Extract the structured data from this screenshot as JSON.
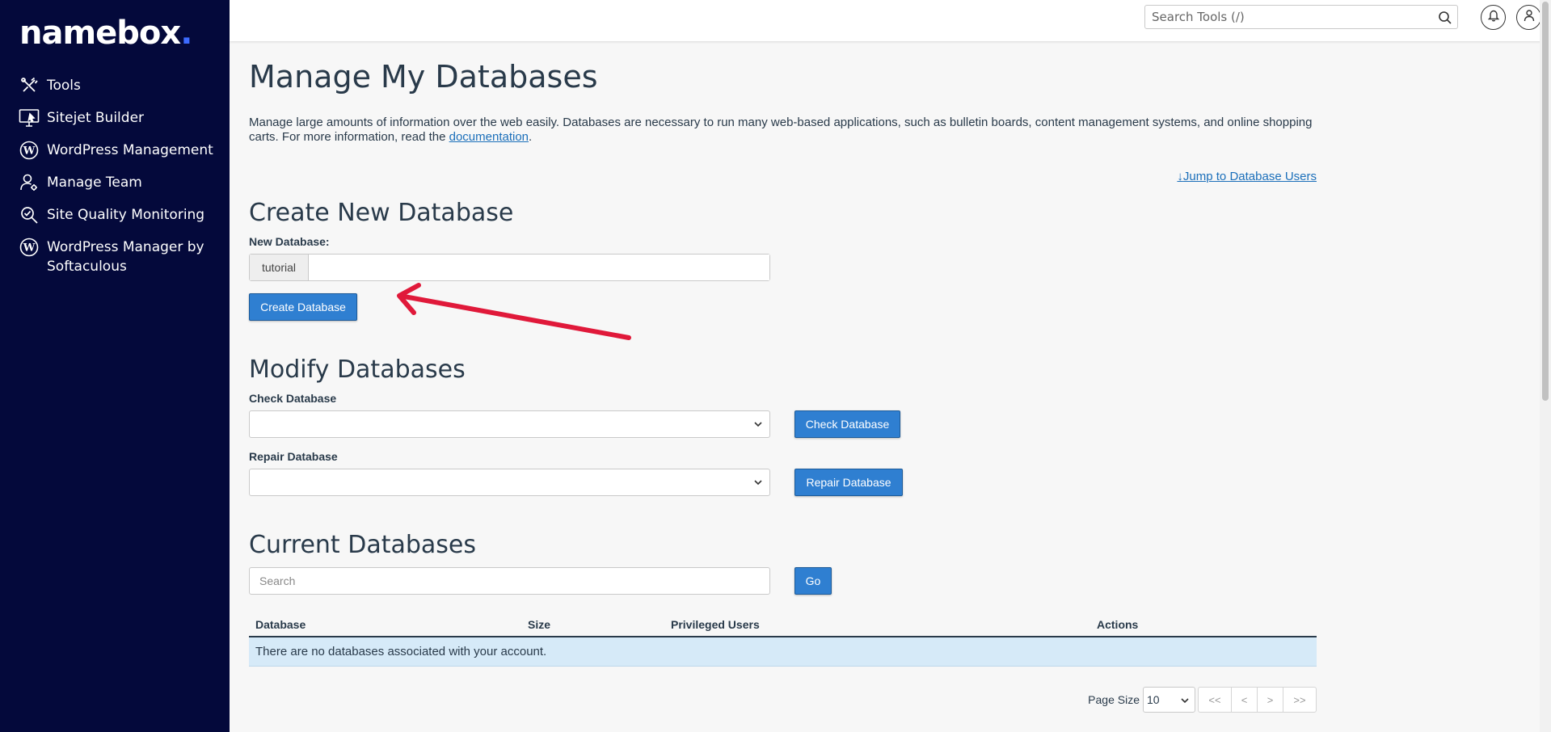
{
  "brand": {
    "logo_text": "namebox",
    "logo_dot": "."
  },
  "sidebar": {
    "items": [
      {
        "label": "Tools",
        "icon": "tools-icon"
      },
      {
        "label": "Sitejet Builder",
        "icon": "monitor-icon"
      },
      {
        "label": "WordPress Management",
        "icon": "wordpress-icon"
      },
      {
        "label": "Manage Team",
        "icon": "user-gear-icon"
      },
      {
        "label": "Site Quality Monitoring",
        "icon": "magnifier-icon"
      },
      {
        "label": "WordPress Manager by Softaculous",
        "icon": "wordpress-icon"
      }
    ]
  },
  "header": {
    "search_placeholder": "Search Tools (/)",
    "icons": [
      "search-icon",
      "bell-icon",
      "user-icon"
    ]
  },
  "main": {
    "title": "Manage My Databases",
    "description_prefix": "Manage large amounts of information over the web easily. Databases are necessary to run many web-based applications, such as bulletin boards, content management systems, and online shopping carts. For more information, read the ",
    "description_link": "documentation",
    "description_suffix": ".",
    "jump_link": "Jump to Database Users",
    "create": {
      "heading": "Create New Database",
      "label": "New Database:",
      "prefix": "tutorial",
      "value": "",
      "button": "Create Database"
    },
    "modify": {
      "heading": "Modify Databases",
      "check_label": "Check Database",
      "check_value": "",
      "check_button": "Check Database",
      "repair_label": "Repair Database",
      "repair_value": "",
      "repair_button": "Repair Database"
    },
    "current": {
      "heading": "Current Databases",
      "search_placeholder": "Search",
      "go_button": "Go",
      "columns": [
        "Database",
        "Size",
        "Privileged Users",
        "Actions"
      ],
      "empty_message": "There are no databases associated with your account."
    },
    "pager": {
      "page_size_label": "Page Size",
      "page_size": "10",
      "buttons": [
        "<<",
        "<",
        ">",
        ">>"
      ]
    }
  },
  "colors": {
    "sidebar_bg": "#04093b",
    "accent": "#2f7fd1",
    "annotation_arrow": "#e0193a",
    "empty_row_bg": "#d6eaf8"
  }
}
